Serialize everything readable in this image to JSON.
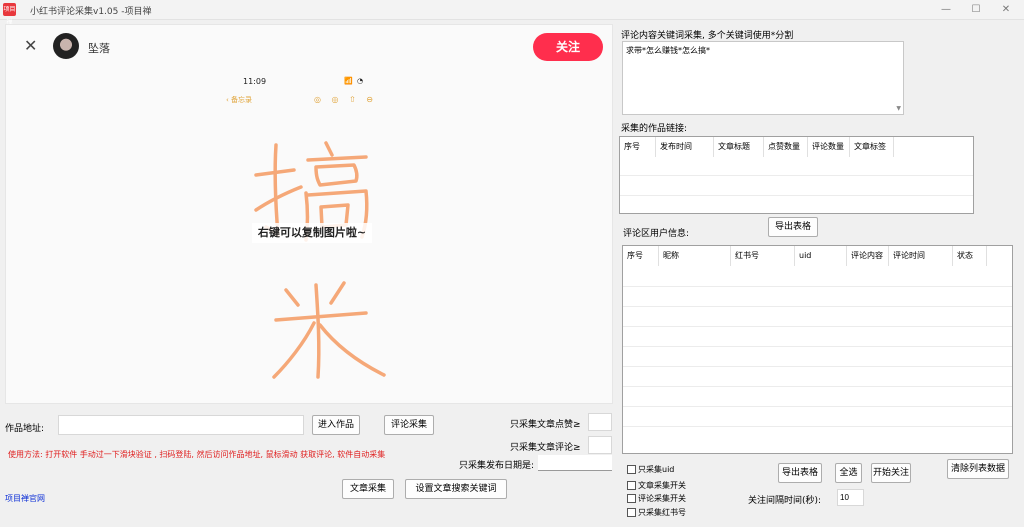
{
  "window": {
    "title": "小红书评论采集v1.05 -项目禅",
    "icon_text": "项目禅"
  },
  "browser": {
    "author_name": "坠落",
    "follow_label": "关注",
    "phone_time": "11:09",
    "phone_status": "📶 ◔",
    "phone_back": "备忘录",
    "phone_icons": "◎ ◎ ⇧ ⊖",
    "handwriting_chars": [
      "搞",
      "米"
    ],
    "copy_tip": "右键可以复制图片啦~"
  },
  "left_controls": {
    "work_url_label": "作品地址:",
    "work_url_value": "",
    "enter_work_button": "进入作品",
    "collect_comments_button": "评论采集",
    "only_likes_label": "只采集文章点赞≥",
    "only_likes_value": "",
    "only_comments_label": "只采集文章评论≥",
    "only_comments_value": "",
    "only_date_label": "只采集发布日期是:",
    "only_date_value": "",
    "usage_text": "使用方法: 打开软件 手动过一下滑块验证   , 扫码登陆, 然后访问作品地址, 鼠标滑动 获取评论, 软件自动采集",
    "article_collect_button": "文章采集",
    "set_keyword_button": "设置文章搜索关键词",
    "site_link": "项目禅官网"
  },
  "right_panel": {
    "keyword_label": "评论内容关键词采集, 多个关键词使用*分割",
    "keyword_value": "求带*怎么赚钱*怎么搞*",
    "works_label": "采集的作品链接:",
    "works_columns": [
      "序号",
      "发布时间",
      "文章标题",
      "点赞数量",
      "评论数量",
      "文章标签"
    ],
    "export_table_button_1": "导出表格",
    "users_label": "评论区用户信息:",
    "users_columns": [
      "序号",
      "昵称",
      "红书号",
      "uid",
      "评论内容",
      "评论时间",
      "状态"
    ],
    "checkbox_only_uid": "只采集uid",
    "checkbox_article_switch": "文章采集开关",
    "checkbox_comment_switch": "评论采集开关",
    "checkbox_only_redbook_id": "只采集红书号",
    "export_table_button_2": "导出表格",
    "select_all_button": "全选",
    "start_follow_button": "开始关注",
    "clear_list_button": "清除列表数据",
    "follow_interval_label": "关注间隔时间(秒):",
    "follow_interval_value": "10"
  }
}
